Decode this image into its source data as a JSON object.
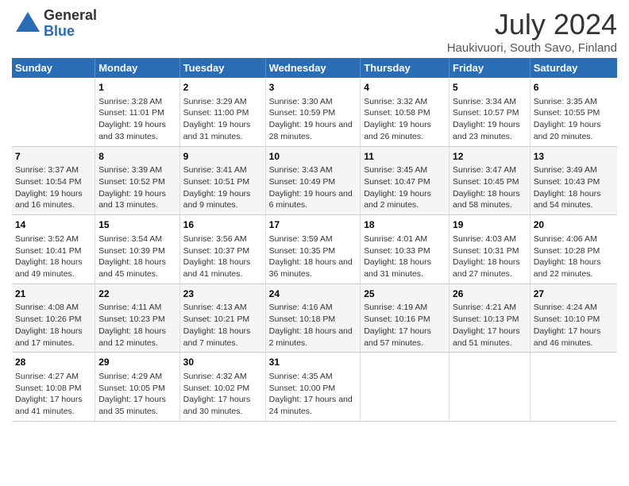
{
  "header": {
    "logo_general": "General",
    "logo_blue": "Blue",
    "title": "July 2024",
    "subtitle": "Haukivuori, South Savo, Finland"
  },
  "days_of_week": [
    "Sunday",
    "Monday",
    "Tuesday",
    "Wednesday",
    "Thursday",
    "Friday",
    "Saturday"
  ],
  "weeks": [
    [
      {
        "day": "",
        "sunrise": "",
        "sunset": "",
        "daylight": ""
      },
      {
        "day": "1",
        "sunrise": "Sunrise: 3:28 AM",
        "sunset": "Sunset: 11:01 PM",
        "daylight": "Daylight: 19 hours and 33 minutes."
      },
      {
        "day": "2",
        "sunrise": "Sunrise: 3:29 AM",
        "sunset": "Sunset: 11:00 PM",
        "daylight": "Daylight: 19 hours and 31 minutes."
      },
      {
        "day": "3",
        "sunrise": "Sunrise: 3:30 AM",
        "sunset": "Sunset: 10:59 PM",
        "daylight": "Daylight: 19 hours and 28 minutes."
      },
      {
        "day": "4",
        "sunrise": "Sunrise: 3:32 AM",
        "sunset": "Sunset: 10:58 PM",
        "daylight": "Daylight: 19 hours and 26 minutes."
      },
      {
        "day": "5",
        "sunrise": "Sunrise: 3:34 AM",
        "sunset": "Sunset: 10:57 PM",
        "daylight": "Daylight: 19 hours and 23 minutes."
      },
      {
        "day": "6",
        "sunrise": "Sunrise: 3:35 AM",
        "sunset": "Sunset: 10:55 PM",
        "daylight": "Daylight: 19 hours and 20 minutes."
      }
    ],
    [
      {
        "day": "7",
        "sunrise": "Sunrise: 3:37 AM",
        "sunset": "Sunset: 10:54 PM",
        "daylight": "Daylight: 19 hours and 16 minutes."
      },
      {
        "day": "8",
        "sunrise": "Sunrise: 3:39 AM",
        "sunset": "Sunset: 10:52 PM",
        "daylight": "Daylight: 19 hours and 13 minutes."
      },
      {
        "day": "9",
        "sunrise": "Sunrise: 3:41 AM",
        "sunset": "Sunset: 10:51 PM",
        "daylight": "Daylight: 19 hours and 9 minutes."
      },
      {
        "day": "10",
        "sunrise": "Sunrise: 3:43 AM",
        "sunset": "Sunset: 10:49 PM",
        "daylight": "Daylight: 19 hours and 6 minutes."
      },
      {
        "day": "11",
        "sunrise": "Sunrise: 3:45 AM",
        "sunset": "Sunset: 10:47 PM",
        "daylight": "Daylight: 19 hours and 2 minutes."
      },
      {
        "day": "12",
        "sunrise": "Sunrise: 3:47 AM",
        "sunset": "Sunset: 10:45 PM",
        "daylight": "Daylight: 18 hours and 58 minutes."
      },
      {
        "day": "13",
        "sunrise": "Sunrise: 3:49 AM",
        "sunset": "Sunset: 10:43 PM",
        "daylight": "Daylight: 18 hours and 54 minutes."
      }
    ],
    [
      {
        "day": "14",
        "sunrise": "Sunrise: 3:52 AM",
        "sunset": "Sunset: 10:41 PM",
        "daylight": "Daylight: 18 hours and 49 minutes."
      },
      {
        "day": "15",
        "sunrise": "Sunrise: 3:54 AM",
        "sunset": "Sunset: 10:39 PM",
        "daylight": "Daylight: 18 hours and 45 minutes."
      },
      {
        "day": "16",
        "sunrise": "Sunrise: 3:56 AM",
        "sunset": "Sunset: 10:37 PM",
        "daylight": "Daylight: 18 hours and 41 minutes."
      },
      {
        "day": "17",
        "sunrise": "Sunrise: 3:59 AM",
        "sunset": "Sunset: 10:35 PM",
        "daylight": "Daylight: 18 hours and 36 minutes."
      },
      {
        "day": "18",
        "sunrise": "Sunrise: 4:01 AM",
        "sunset": "Sunset: 10:33 PM",
        "daylight": "Daylight: 18 hours and 31 minutes."
      },
      {
        "day": "19",
        "sunrise": "Sunrise: 4:03 AM",
        "sunset": "Sunset: 10:31 PM",
        "daylight": "Daylight: 18 hours and 27 minutes."
      },
      {
        "day": "20",
        "sunrise": "Sunrise: 4:06 AM",
        "sunset": "Sunset: 10:28 PM",
        "daylight": "Daylight: 18 hours and 22 minutes."
      }
    ],
    [
      {
        "day": "21",
        "sunrise": "Sunrise: 4:08 AM",
        "sunset": "Sunset: 10:26 PM",
        "daylight": "Daylight: 18 hours and 17 minutes."
      },
      {
        "day": "22",
        "sunrise": "Sunrise: 4:11 AM",
        "sunset": "Sunset: 10:23 PM",
        "daylight": "Daylight: 18 hours and 12 minutes."
      },
      {
        "day": "23",
        "sunrise": "Sunrise: 4:13 AM",
        "sunset": "Sunset: 10:21 PM",
        "daylight": "Daylight: 18 hours and 7 minutes."
      },
      {
        "day": "24",
        "sunrise": "Sunrise: 4:16 AM",
        "sunset": "Sunset: 10:18 PM",
        "daylight": "Daylight: 18 hours and 2 minutes."
      },
      {
        "day": "25",
        "sunrise": "Sunrise: 4:19 AM",
        "sunset": "Sunset: 10:16 PM",
        "daylight": "Daylight: 17 hours and 57 minutes."
      },
      {
        "day": "26",
        "sunrise": "Sunrise: 4:21 AM",
        "sunset": "Sunset: 10:13 PM",
        "daylight": "Daylight: 17 hours and 51 minutes."
      },
      {
        "day": "27",
        "sunrise": "Sunrise: 4:24 AM",
        "sunset": "Sunset: 10:10 PM",
        "daylight": "Daylight: 17 hours and 46 minutes."
      }
    ],
    [
      {
        "day": "28",
        "sunrise": "Sunrise: 4:27 AM",
        "sunset": "Sunset: 10:08 PM",
        "daylight": "Daylight: 17 hours and 41 minutes."
      },
      {
        "day": "29",
        "sunrise": "Sunrise: 4:29 AM",
        "sunset": "Sunset: 10:05 PM",
        "daylight": "Daylight: 17 hours and 35 minutes."
      },
      {
        "day": "30",
        "sunrise": "Sunrise: 4:32 AM",
        "sunset": "Sunset: 10:02 PM",
        "daylight": "Daylight: 17 hours and 30 minutes."
      },
      {
        "day": "31",
        "sunrise": "Sunrise: 4:35 AM",
        "sunset": "Sunset: 10:00 PM",
        "daylight": "Daylight: 17 hours and 24 minutes."
      },
      {
        "day": "",
        "sunrise": "",
        "sunset": "",
        "daylight": ""
      },
      {
        "day": "",
        "sunrise": "",
        "sunset": "",
        "daylight": ""
      },
      {
        "day": "",
        "sunrise": "",
        "sunset": "",
        "daylight": ""
      }
    ]
  ]
}
